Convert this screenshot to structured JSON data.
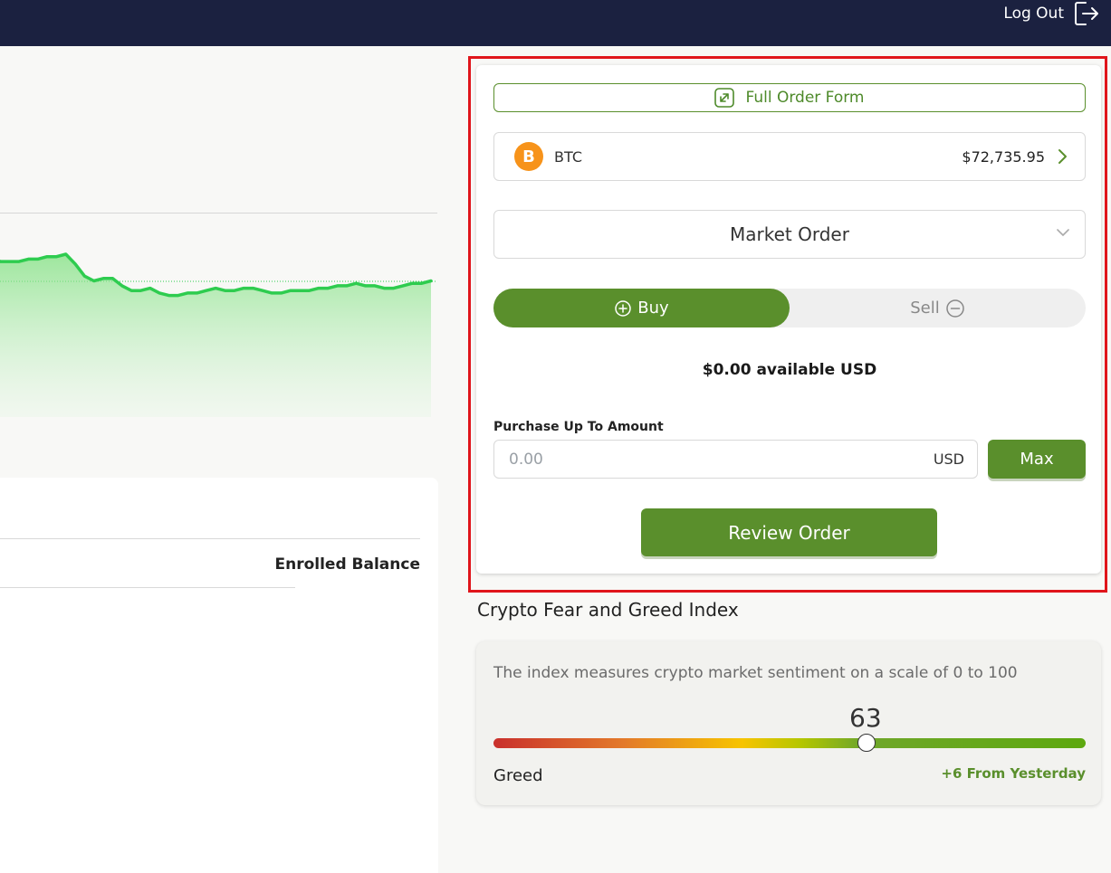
{
  "header": {
    "logout_label": "Log Out",
    "logout_icon": "logout-icon",
    "background_color": "#1b2140"
  },
  "chart": {
    "line_color": "#2ecc4f",
    "values": [
      71,
      69,
      69,
      69,
      70,
      70,
      71,
      71,
      72,
      68,
      63,
      61,
      62,
      62,
      59,
      57,
      57,
      58,
      56,
      55,
      55,
      56,
      56,
      57,
      58,
      57,
      57,
      58,
      58,
      57,
      56,
      56,
      57,
      57,
      57,
      58,
      58,
      59,
      59,
      60,
      59,
      59,
      58,
      58,
      59,
      60,
      60,
      61
    ]
  },
  "balance": {
    "enrolled_header": "Enrolled Balance"
  },
  "order": {
    "full_order_label": "Full Order Form",
    "asset": {
      "symbol": "BTC",
      "price": "$72,735.95",
      "icon": "bitcoin-icon",
      "icon_letter": "B"
    },
    "order_type": "Market Order",
    "buy_label": "Buy",
    "sell_label": "Sell",
    "active_side": "buy",
    "available": "$0.00 available USD",
    "amount_label": "Purchase Up To Amount",
    "amount_placeholder": "0.00",
    "amount_unit": "USD",
    "max_label": "Max",
    "review_label": "Review Order",
    "accent_color": "#5a8f2c",
    "highlight_color": "#e0151b"
  },
  "fear_greed": {
    "title": "Crypto Fear and Greed Index",
    "description": "The index measures crypto market sentiment on a scale of 0 to 100",
    "value": "63",
    "value_number": 63,
    "label": "Greed",
    "change": "+6 From Yesterday"
  }
}
